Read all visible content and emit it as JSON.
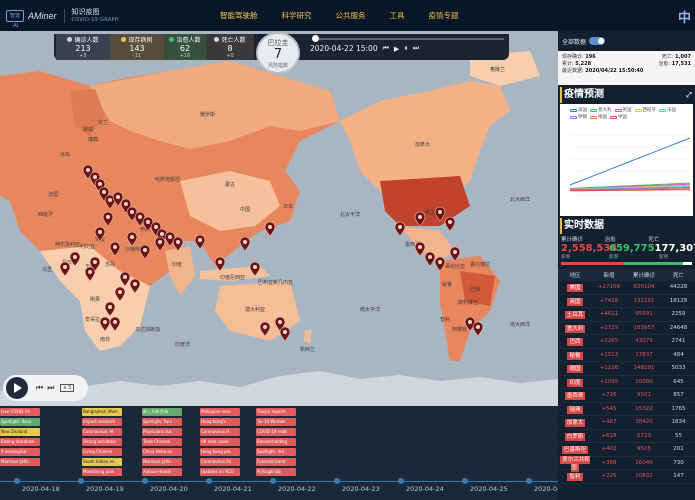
{
  "header": {
    "logo_mark": "智谱·AI",
    "logo_brand": "AMiner",
    "logo_title": "知识疫图",
    "logo_subtitle": "COVID-19 GRAPH",
    "nav": [
      "智能驾驶舱",
      "科学研究",
      "公共服务",
      "工具",
      "疫情专题"
    ],
    "lang": "中"
  },
  "stats": {
    "confirmed": {
      "label": "确诊人数",
      "value": "213",
      "delta": "+5",
      "color": "#c9d3e0"
    },
    "existing": {
      "label": "现存病例",
      "value": "143",
      "delta": "-11",
      "color": "#e6c15a"
    },
    "cured": {
      "label": "治愈人数",
      "value": "62",
      "delta": "+16",
      "color": "#3fbd6b"
    },
    "dead": {
      "label": "死亡人数",
      "value": "8",
      "delta": "+0",
      "color": "#dcdcdc"
    }
  },
  "country_badge": {
    "name": "巴拉圭",
    "risk_value": "7",
    "risk_label": "风险指数"
  },
  "date_control": {
    "date": "2020-04-22 15:00",
    "prev": "⏮",
    "play": "▶",
    "pause": "⏸",
    "next": "⏭"
  },
  "map_labels": [
    {
      "text": "冰岛"
    },
    {
      "text": "挪威"
    },
    {
      "text": "芬兰"
    },
    {
      "text": "瑞典"
    },
    {
      "text": "俄罗斯"
    },
    {
      "text": "格陵兰"
    },
    {
      "text": "加拿大"
    },
    {
      "text": "美国"
    },
    {
      "text": "墨西哥"
    },
    {
      "text": "巴西"
    },
    {
      "text": "秘鲁"
    },
    {
      "text": "阿根廷"
    },
    {
      "text": "智利"
    },
    {
      "text": "哥伦比亚"
    },
    {
      "text": "委内瑞拉"
    },
    {
      "text": "哈萨克斯坦"
    },
    {
      "text": "蒙古"
    },
    {
      "text": "中国"
    },
    {
      "text": "印度"
    },
    {
      "text": "伊朗"
    },
    {
      "text": "沙特阿拉伯"
    },
    {
      "text": "埃及"
    },
    {
      "text": "利比亚"
    },
    {
      "text": "阿尔及利亚"
    },
    {
      "text": "尼日尔"
    },
    {
      "text": "乍得"
    },
    {
      "text": "苏丹"
    },
    {
      "text": "马里"
    },
    {
      "text": "刚果"
    },
    {
      "text": "安哥拉"
    },
    {
      "text": "南非"
    },
    {
      "text": "马达加斯加"
    },
    {
      "text": "澳大利亚"
    },
    {
      "text": "印度尼西亚"
    },
    {
      "text": "日本"
    },
    {
      "text": "新西兰"
    },
    {
      "text": "巴布亚新几内亚"
    },
    {
      "text": "玻利维亚"
    },
    {
      "text": "法国"
    },
    {
      "text": "西班牙"
    },
    {
      "text": "北太平洋"
    },
    {
      "text": "南太平洋"
    },
    {
      "text": "北大西洋"
    },
    {
      "text": "南大西洋"
    },
    {
      "text": "印度洋"
    }
  ],
  "play_control": {
    "speed": "x 3"
  },
  "timeline": {
    "dates": [
      "2020-04-18",
      "2020-04-19",
      "2020-04-20",
      "2020-04-21",
      "2020-04-22",
      "2020-04-23",
      "2020-04-24",
      "2020-04-25",
      "2020-04-26"
    ],
    "columns": [
      {
        "items": [
          {
            "c": "red",
            "t": "Live COVID-19"
          },
          {
            "c": "green",
            "t": "Spotlight: Reco"
          },
          {
            "c": "yellow",
            "t": "New Zealand"
          },
          {
            "c": "red",
            "t": "Easing lockdown"
          },
          {
            "c": "red",
            "t": "A serological"
          },
          {
            "c": "red",
            "t": "Morrison-Jaffe"
          }
        ]
      },
      {
        "items": [
          {
            "c": "yellow",
            "t": "Bangladesh Wom"
          },
          {
            "c": "red",
            "t": "Impact assessm"
          },
          {
            "c": "red",
            "t": "Coronavirus: M"
          },
          {
            "c": "red",
            "t": "Strong lockdown"
          },
          {
            "c": "red",
            "t": "Living Chinese"
          },
          {
            "c": "yellow",
            "t": "South Indian en"
          },
          {
            "c": "red",
            "t": "Monitoring plan"
          }
        ]
      },
      {
        "items": [
          {
            "c": "green",
            "t": "新三不承·民族"
          },
          {
            "c": "red",
            "t": "Spotlight: Pars"
          },
          {
            "c": "red",
            "t": "Physicians sto"
          },
          {
            "c": "red",
            "t": "Treat Chinese"
          },
          {
            "c": "red",
            "t": "China Hohe ex"
          },
          {
            "c": "red",
            "t": "Morrison-Jaffe"
          },
          {
            "c": "red",
            "t": "Xinhua Headli"
          }
        ]
      },
      {
        "items": [
          {
            "c": "red",
            "t": "Philippine reco"
          },
          {
            "c": "red",
            "t": "Hong Kong's"
          },
          {
            "c": "red",
            "t": "Coronavirus H"
          },
          {
            "c": "red",
            "t": "UK new cases"
          },
          {
            "c": "red",
            "t": "Hong Kong pro"
          },
          {
            "c": "red",
            "t": "Coronavirus Pa"
          },
          {
            "c": "red",
            "t": "Updates on NCO"
          }
        ]
      },
      {
        "items": [
          {
            "c": "red",
            "t": "Tianjin reports"
          },
          {
            "c": "red",
            "t": "Tor-10 Women"
          },
          {
            "c": "red",
            "t": "COVID-19 relat"
          },
          {
            "c": "red",
            "t": "Record-holding"
          },
          {
            "c": "red",
            "t": "Spotlight: Ind"
          },
          {
            "c": "red",
            "t": "Funerals bond"
          },
          {
            "c": "red",
            "t": "Portugal lab"
          }
        ]
      }
    ]
  },
  "panel": {
    "toggle_label": "全部数据",
    "info": {
      "existing_label": "现存确诊",
      "existing_value": "196",
      "dead_label": "死亡",
      "dead_value": "1,007",
      "cases_label": "累计",
      "cases_value": "5,228",
      "cured_label": "治愈",
      "cured_value": "17,531",
      "update_label": "最近数据",
      "update_value": "2020/04/22 15:50:40"
    },
    "forecast_title": "疫情预测",
    "forecast_legend": [
      {
        "name": "美国",
        "color": "#3f79d8"
      },
      {
        "name": "意大利",
        "color": "#3fbd6b"
      },
      {
        "name": "英国",
        "color": "#d14fd0"
      },
      {
        "name": "西班牙",
        "color": "#e6c15a"
      },
      {
        "name": "法国",
        "color": "#55c6c9"
      },
      {
        "name": "伊朗",
        "color": "#9a6ad8"
      },
      {
        "name": "德国",
        "color": "#e07a3f"
      },
      {
        "name": "中国",
        "color": "#e04848"
      }
    ],
    "realtime_title": "实时数据",
    "realtime": {
      "confirmed_label": "累计确诊",
      "confirmed_value": "2,558,534",
      "confirmed_sub": "新增",
      "cured_label": "治愈",
      "cured_value": "659,775",
      "cured_sub": "新增",
      "dead_label": "死亡",
      "dead_value": "177,307",
      "dead_sub": "新增"
    },
    "table": {
      "headers": [
        "地区",
        "新增",
        "累计确诊",
        "死亡"
      ],
      "rows": [
        [
          "美国",
          "+27108",
          "820104",
          "44228"
        ],
        [
          "英国",
          "+7418",
          "132161",
          "18128"
        ],
        [
          "土耳其",
          "+4611",
          "95591",
          "2259"
        ],
        [
          "意大利",
          "+2729",
          "183957",
          "24648"
        ],
        [
          "巴西",
          "+2265",
          "43079",
          "2741"
        ],
        [
          "秘鲁",
          "+1512",
          "17837",
          "484"
        ],
        [
          "德国",
          "+1226",
          "148291",
          "5033"
        ],
        [
          "印度",
          "+1095",
          "20080",
          "645"
        ],
        [
          "墨西哥",
          "+726",
          "9501",
          "857"
        ],
        [
          "瑞典",
          "+545",
          "15322",
          "1765"
        ],
        [
          "加拿大",
          "+467",
          "38420",
          "1834"
        ],
        [
          "白罗斯",
          "+618",
          "6723",
          "55"
        ],
        [
          "巴基斯坦",
          "+402",
          "9505",
          "201"
        ],
        [
          "爱尔兰共和国",
          "+388",
          "16040",
          "730"
        ],
        [
          "智利",
          "+225",
          "10832",
          "147"
        ]
      ]
    }
  }
}
